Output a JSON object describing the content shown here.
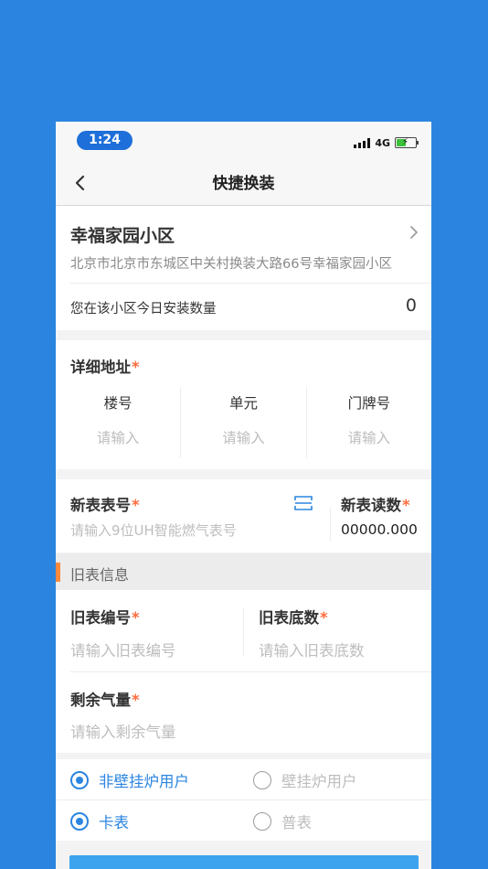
{
  "status_bar": {
    "time": "1:24",
    "network": "4G"
  },
  "nav": {
    "title": "快捷换装"
  },
  "community": {
    "name": "幸福家园小区",
    "address": "北京市北京市东城区中关村换装大路66号幸福家园小区",
    "today_label": "您在该小区今日安装数量",
    "today_count": "0"
  },
  "detail_address": {
    "title": "详细地址",
    "required_mark": "*",
    "columns": [
      {
        "label": "楼号",
        "placeholder": "请输入"
      },
      {
        "label": "单元",
        "placeholder": "请输入"
      },
      {
        "label": "门牌号",
        "placeholder": "请输入"
      }
    ]
  },
  "new_meter": {
    "number_label": "新表表号",
    "number_placeholder": "请输入9位UH智能燃气表号",
    "reading_label": "新表读数",
    "reading_value": "00000.000",
    "required_mark": "*"
  },
  "old_meter_section": {
    "title": "旧表信息"
  },
  "old_meter": {
    "number_label": "旧表编号",
    "number_placeholder": "请输入旧表编号",
    "base_label": "旧表底数",
    "base_placeholder": "请输入旧表底数",
    "remaining_label": "剩余气量",
    "remaining_placeholder": "请输入剩余气量",
    "required_mark": "*"
  },
  "user_type": {
    "options": [
      {
        "label": "非壁挂炉用户",
        "selected": true
      },
      {
        "label": "壁挂炉用户",
        "selected": false
      }
    ]
  },
  "meter_type": {
    "options": [
      {
        "label": "卡表",
        "selected": true
      },
      {
        "label": "普表",
        "selected": false
      }
    ]
  },
  "colors": {
    "background": "#2b85e0",
    "accent": "#2b85e0",
    "required": "#ff6b3d",
    "section_marker": "#ff8a3d",
    "submit": "#3ca3ee"
  },
  "icons": [
    "back-chevron-icon",
    "chevron-right-icon",
    "scan-icon",
    "signal-icon",
    "battery-charging-icon"
  ]
}
